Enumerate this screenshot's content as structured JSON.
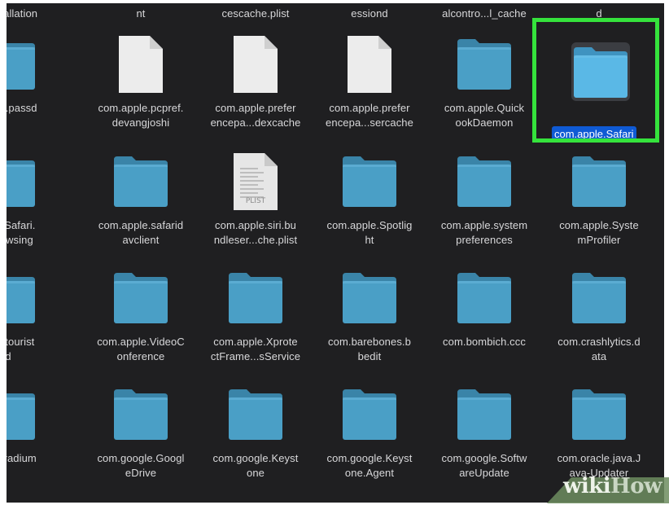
{
  "top_row_labels": [
    "A...stallation",
    "nt",
    "cescache.plist",
    "essiond",
    "alcontro...l_cache",
    "d"
  ],
  "rows": [
    [
      {
        "label": "apple.passd",
        "icon": "folder"
      },
      {
        "label": "com.apple.pcpref.\ndevangjoshi",
        "icon": "document"
      },
      {
        "label": "com.apple.prefer\nencepa...dexcache",
        "icon": "document"
      },
      {
        "label": "com.apple.prefer\nencepa...sercache",
        "icon": "document"
      },
      {
        "label": "com.apple.Quick\nookDaemon",
        "icon": "folder"
      },
      {
        "label": "com.apple.Safari",
        "icon": "folder",
        "selected": true
      }
    ],
    [
      {
        "label": "pple.Safari.\neBrowsing",
        "icon": "folder"
      },
      {
        "label": "com.apple.safarid\navclient",
        "icon": "folder"
      },
      {
        "label": "com.apple.siri.bu\nndleser...che.plist",
        "icon": "plist"
      },
      {
        "label": "com.apple.Spotlig\nht",
        "icon": "folder"
      },
      {
        "label": "com.apple.system\npreferences",
        "icon": "folder"
      },
      {
        "label": "com.apple.Syste\nmProfiler",
        "icon": "folder"
      }
    ],
    [
      {
        "label": "pple.tourist\nd",
        "icon": "folder"
      },
      {
        "label": "com.apple.VideoC\nonference",
        "icon": "folder"
      },
      {
        "label": "com.apple.Xprote\nctFrame...sService",
        "icon": "folder"
      },
      {
        "label": "com.barebones.b\nbedit",
        "icon": "folder"
      },
      {
        "label": "com.bombich.ccc",
        "icon": "folder"
      },
      {
        "label": "com.crashlytics.d\nata",
        "icon": "folder"
      }
    ],
    [
      {
        "label": "urse.radium",
        "icon": "folder"
      },
      {
        "label": "com.google.Googl\neDrive",
        "icon": "folder"
      },
      {
        "label": "com.google.Keyst\none",
        "icon": "folder"
      },
      {
        "label": "com.google.Keyst\none.Agent",
        "icon": "folder"
      },
      {
        "label": "com.google.Softw\nareUpdate",
        "icon": "folder"
      },
      {
        "label": "com.oracle.java.J\nava-Updater",
        "icon": "folder"
      }
    ]
  ],
  "plist_badge": "PLIST",
  "watermark": {
    "part1": "wiki",
    "part2": "How"
  },
  "colors": {
    "background": "#1f1f21",
    "folder": "#4a9fc6",
    "folder_selected": "#5ab8e6",
    "selection_highlight": "#0f5ad4",
    "callout_border": "#35e33c"
  }
}
